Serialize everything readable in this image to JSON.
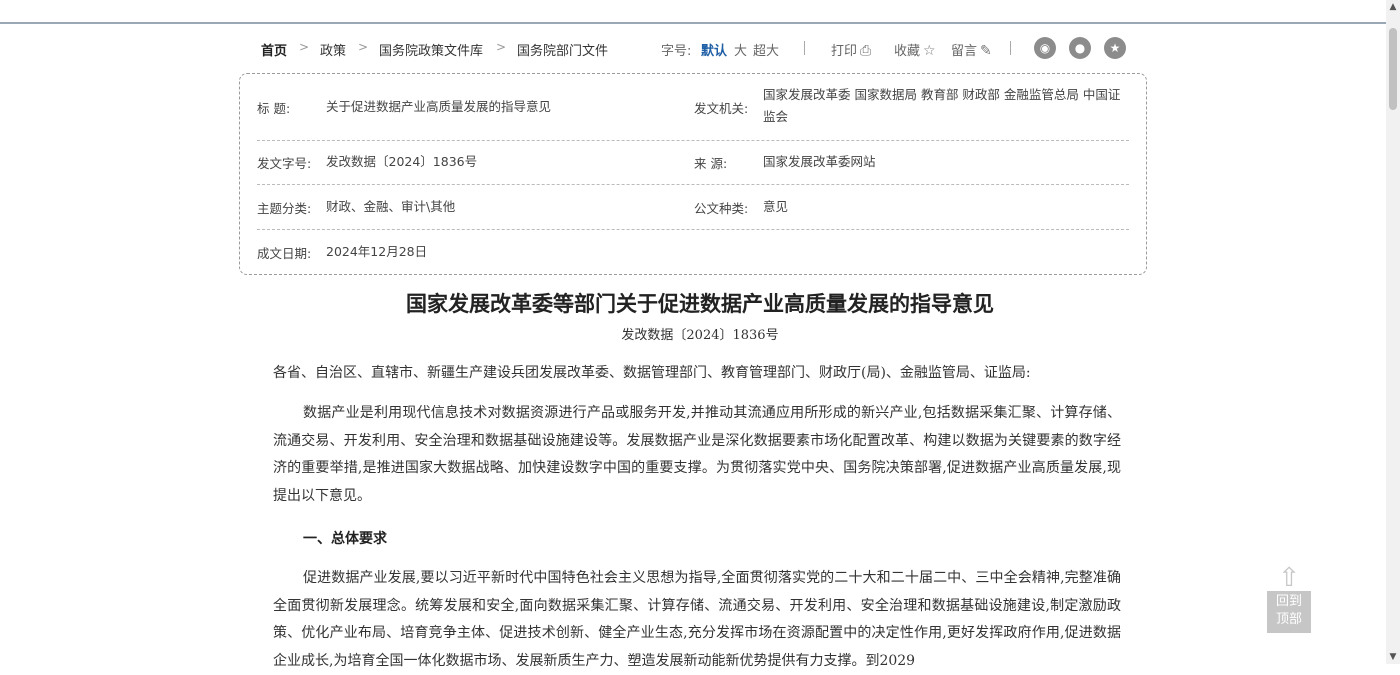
{
  "breadcrumb": [
    "首页",
    "政策",
    "国务院政策文件库",
    "国务院部门文件"
  ],
  "breadcrumb_separator": ">",
  "tools": {
    "font_size_label": "字号:",
    "font_default": "默认",
    "font_large": "大",
    "font_xlarge": "超大",
    "print": "打印",
    "favorite": "收藏",
    "comment": "留言"
  },
  "social": [
    "weibo-icon",
    "wechat-icon",
    "star-icon"
  ],
  "meta": {
    "title_label": "标 题:",
    "title_value": "关于促进数据产业高质量发展的指导意见",
    "issuer_label": "发文机关:",
    "issuer_value": "国家发展改革委 国家数据局 教育部 财政部 金融监管总局 中国证监会",
    "docno_label": "发文字号:",
    "docno_value": "发改数据〔2024〕1836号",
    "source_label": "来 源:",
    "source_value": "国家发展改革委网站",
    "topic_label": "主题分类:",
    "topic_value": "财政、金融、审计\\其他",
    "type_label": "公文种类:",
    "type_value": "意见",
    "date_label": "成文日期:",
    "date_value": "2024年12月28日"
  },
  "document": {
    "title": "国家发展改革委等部门关于促进数据产业高质量发展的指导意见",
    "number": "发改数据〔2024〕1836号",
    "addressee": "各省、自治区、直辖市、新疆生产建设兵团发展改革委、数据管理部门、教育管理部门、财政厅(局)、金融监管局、证监局:",
    "para1": "数据产业是利用现代信息技术对数据资源进行产品或服务开发,并推动其流通应用所形成的新兴产业,包括数据采集汇聚、计算存储、流通交易、开发利用、安全治理和数据基础设施建设等。发展数据产业是深化数据要素市场化配置改革、构建以数据为关键要素的数字经济的重要举措,是推进国家大数据战略、加快建设数字中国的重要支撑。为贯彻落实党中央、国务院决策部署,促进数据产业高质量发展,现提出以下意见。",
    "section1": "一、总体要求",
    "para2": "促进数据产业发展,要以习近平新时代中国特色社会主义思想为指导,全面贯彻落实党的二十大和二十届二中、三中全会精神,完整准确全面贯彻新发展理念。统筹发展和安全,面向数据采集汇聚、计算存储、流通交易、开发利用、安全治理和数据基础设施建设,制定激励政策、优化产业布局、培育竞争主体、促进技术创新、健全产业生态,充分发挥市场在资源配置中的决定性作用,更好发挥政府作用,促进数据企业成长,为培育全国一体化数据市场、发展新质生产力、塑造发展新动能新优势提供有力支撑。到2029"
  },
  "back_to_top": {
    "line1": "回到",
    "line2": "顶部"
  }
}
